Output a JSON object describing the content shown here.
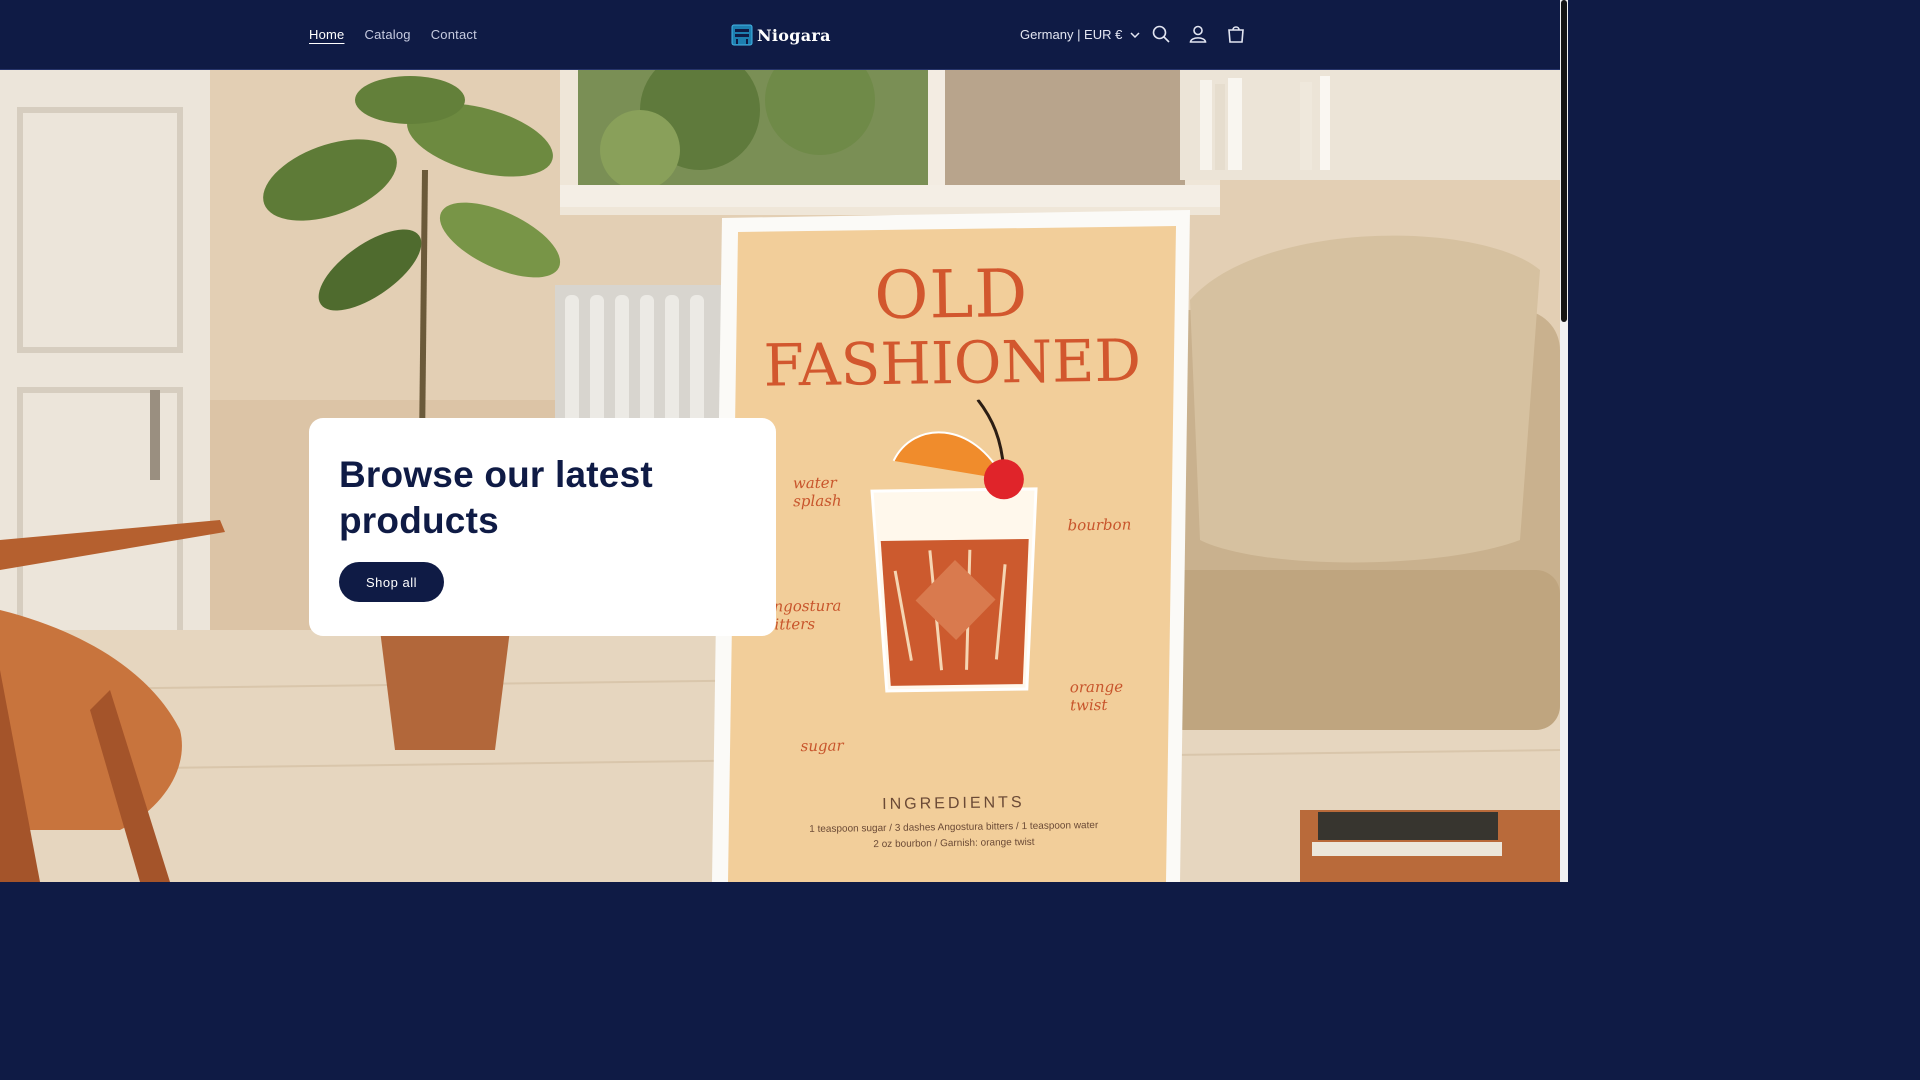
{
  "header": {
    "nav": [
      {
        "label": "Home"
      },
      {
        "label": "Catalog"
      },
      {
        "label": "Contact"
      }
    ],
    "logo_text": "Niogara",
    "locale_label": "Germany | EUR €",
    "icons": [
      "search-icon",
      "account-icon",
      "cart-icon"
    ]
  },
  "hero": {
    "title": "Browse our latest products",
    "button_label": "Shop all",
    "poster": {
      "title_line1": "OLD",
      "title_line2": "FASHIONED",
      "labels": [
        "water splash",
        "bourbon",
        "angostura bitters",
        "orange twist",
        "sugar"
      ],
      "ingredients_heading": "INGREDIENTS",
      "ingredients_line1": "1 teaspoon sugar / 3 dashes Angostura bitters / 1 teaspoon water",
      "ingredients_line2": "2 oz bourbon / Garnish: orange twist"
    }
  },
  "colors": {
    "brand_navy": "#0f1b45",
    "poster_orange": "#d2572e",
    "poster_background": "#f2ce9a"
  }
}
